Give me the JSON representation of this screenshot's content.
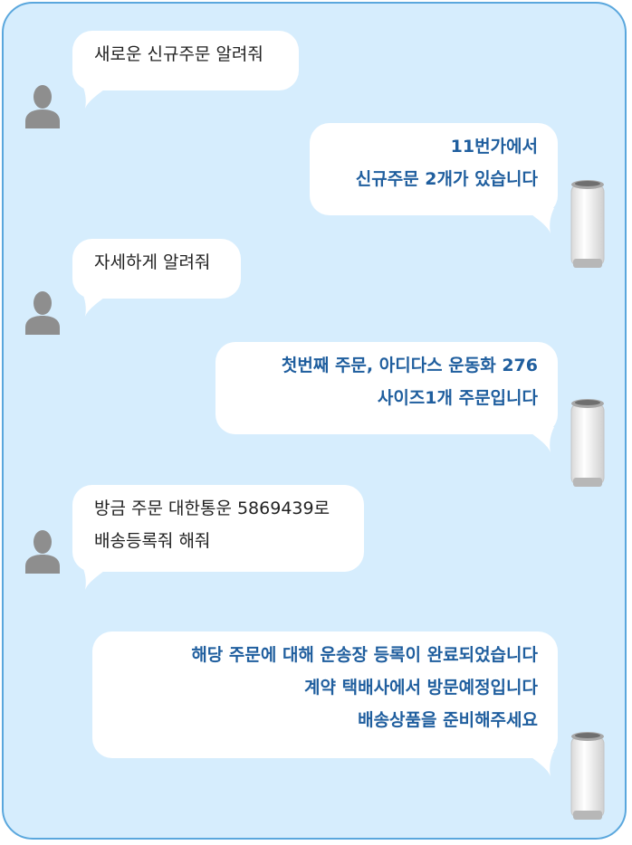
{
  "colors": {
    "frame_background": "#d6edfd",
    "frame_border": "#5aa7dd",
    "bubble": "#ffffff",
    "user_text": "#222222",
    "bot_text": "#1f5e9e",
    "avatar": "#8e8e8e"
  },
  "icons": {
    "user": "user-silhouette-icon",
    "bot": "air-purifier-device-icon"
  },
  "messages": [
    {
      "sender": "user",
      "lines": [
        "새로운 신규주문 알려줘"
      ]
    },
    {
      "sender": "bot",
      "lines": [
        "11번가에서",
        "신규주문 2개가 있습니다"
      ]
    },
    {
      "sender": "user",
      "lines": [
        "자세하게 알려줘"
      ]
    },
    {
      "sender": "bot",
      "lines": [
        "첫번째 주문, 아디다스 운동화 276",
        "사이즈1개 주문입니다"
      ]
    },
    {
      "sender": "user",
      "lines": [
        "방금 주문 대한통운 5869439로",
        "배송등록줘 해줘"
      ]
    },
    {
      "sender": "bot",
      "lines": [
        "해당 주문에 대해 운송장 등록이 완료되었습니다",
        "계약 택배사에서 방문예정입니다",
        "배송상품을 준비해주세요"
      ]
    }
  ]
}
